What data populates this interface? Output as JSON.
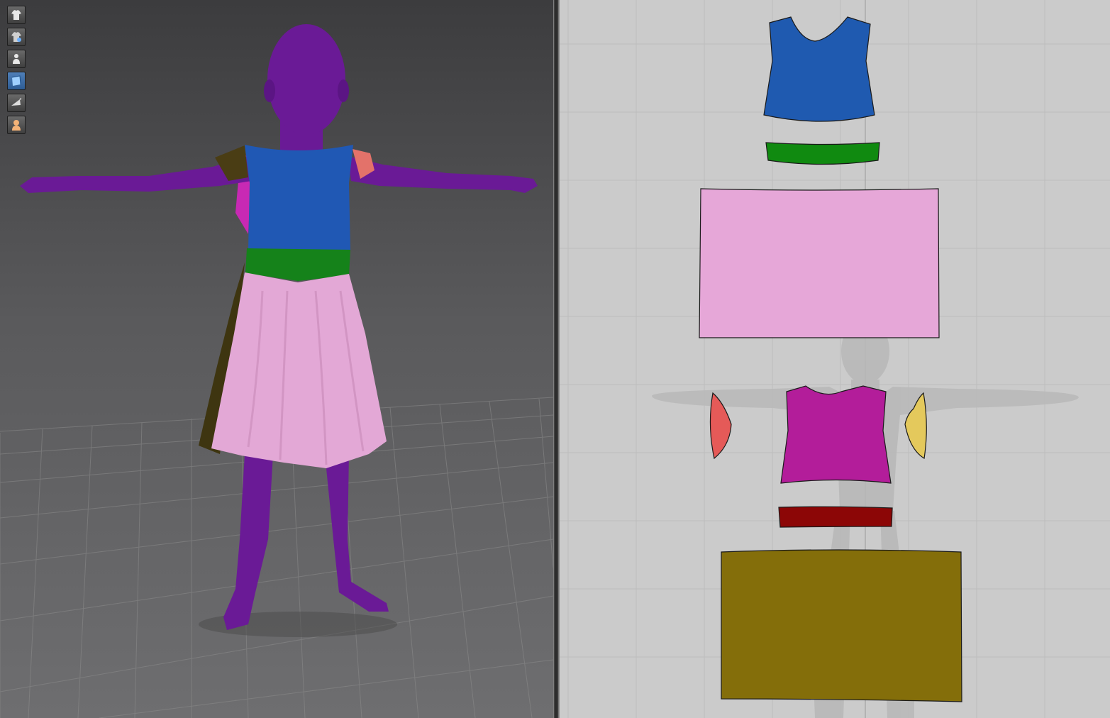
{
  "viewport_3d": {
    "toolbar": {
      "buttons": [
        {
          "icon": "garment-show-icon"
        },
        {
          "icon": "garment-select-icon"
        },
        {
          "icon": "avatar-icon"
        },
        {
          "icon": "texture-icon"
        },
        {
          "icon": "fold-arrangement-icon"
        },
        {
          "icon": "skin-avatar-icon"
        }
      ]
    },
    "avatar_color": "#6a1a96"
  },
  "pattern_pieces": {
    "bodice_front": {
      "color": "#1f5ab0"
    },
    "waistband_front": {
      "color": "#108a10"
    },
    "skirt_front": {
      "color": "#e6a7d8"
    },
    "sleeve_left": {
      "color": "#e55a58"
    },
    "bodice_back": {
      "color": "#b31d9a"
    },
    "sleeve_right": {
      "color": "#e4c95c"
    },
    "waistband_back": {
      "color": "#8c0606"
    },
    "skirt_back": {
      "color": "#846e0a"
    }
  }
}
